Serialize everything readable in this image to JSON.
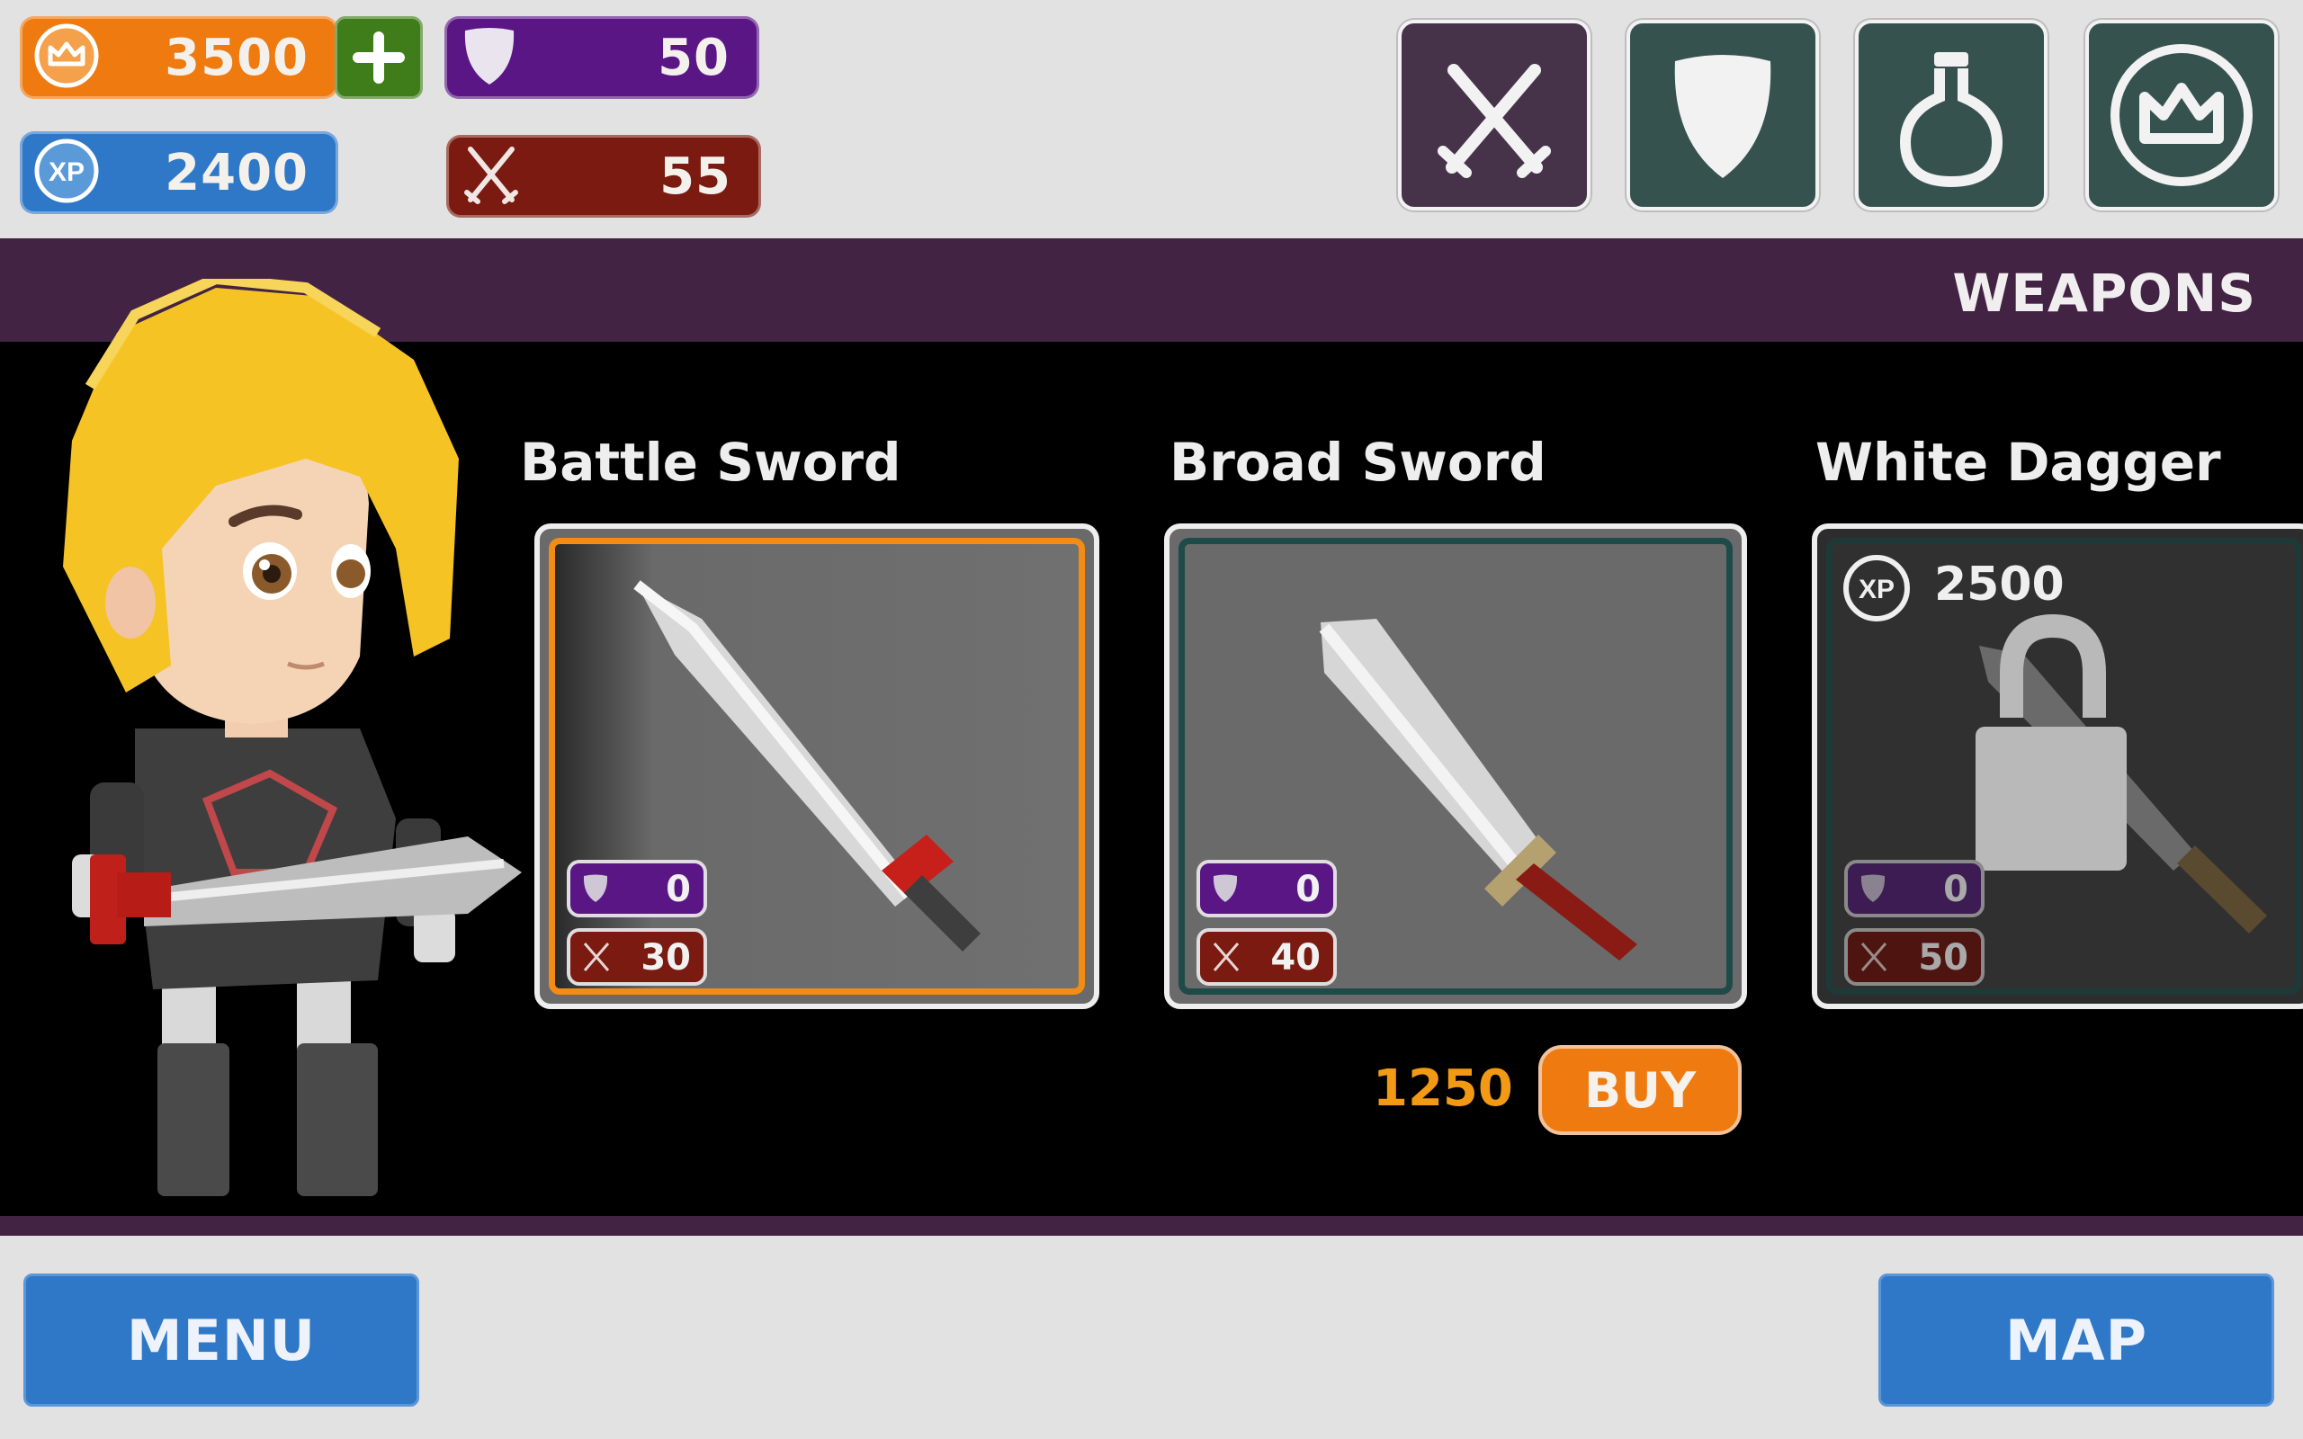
{
  "currencies": {
    "gold": "3500",
    "xp": "2400",
    "armor": "50",
    "attack": "55"
  },
  "categories": [
    {
      "name": "weapons",
      "icon": "crossed-swords-icon"
    },
    {
      "name": "armor",
      "icon": "shield-icon"
    },
    {
      "name": "potions",
      "icon": "potion-icon"
    },
    {
      "name": "crown",
      "icon": "crown-icon"
    }
  ],
  "section_title": "WEAPONS",
  "items": [
    {
      "name": "Battle Sword",
      "armor": "0",
      "attack": "30",
      "state": "selected"
    },
    {
      "name": "Broad Sword",
      "armor": "0",
      "attack": "40",
      "state": "owned"
    },
    {
      "name": "White Dagger",
      "armor": "0",
      "attack": "50",
      "state": "locked",
      "xp_cost": "2500"
    }
  ],
  "purchase": {
    "price": "1250",
    "buy_label": "BUY"
  },
  "nav": {
    "menu_label": "MENU",
    "map_label": "MAP"
  },
  "colors": {
    "gold": "#ef7a10",
    "xp": "#2f78c8",
    "armor": "#5a1685",
    "attack": "#7a1a10",
    "band": "#432343",
    "selected_border": "#f28c14"
  }
}
